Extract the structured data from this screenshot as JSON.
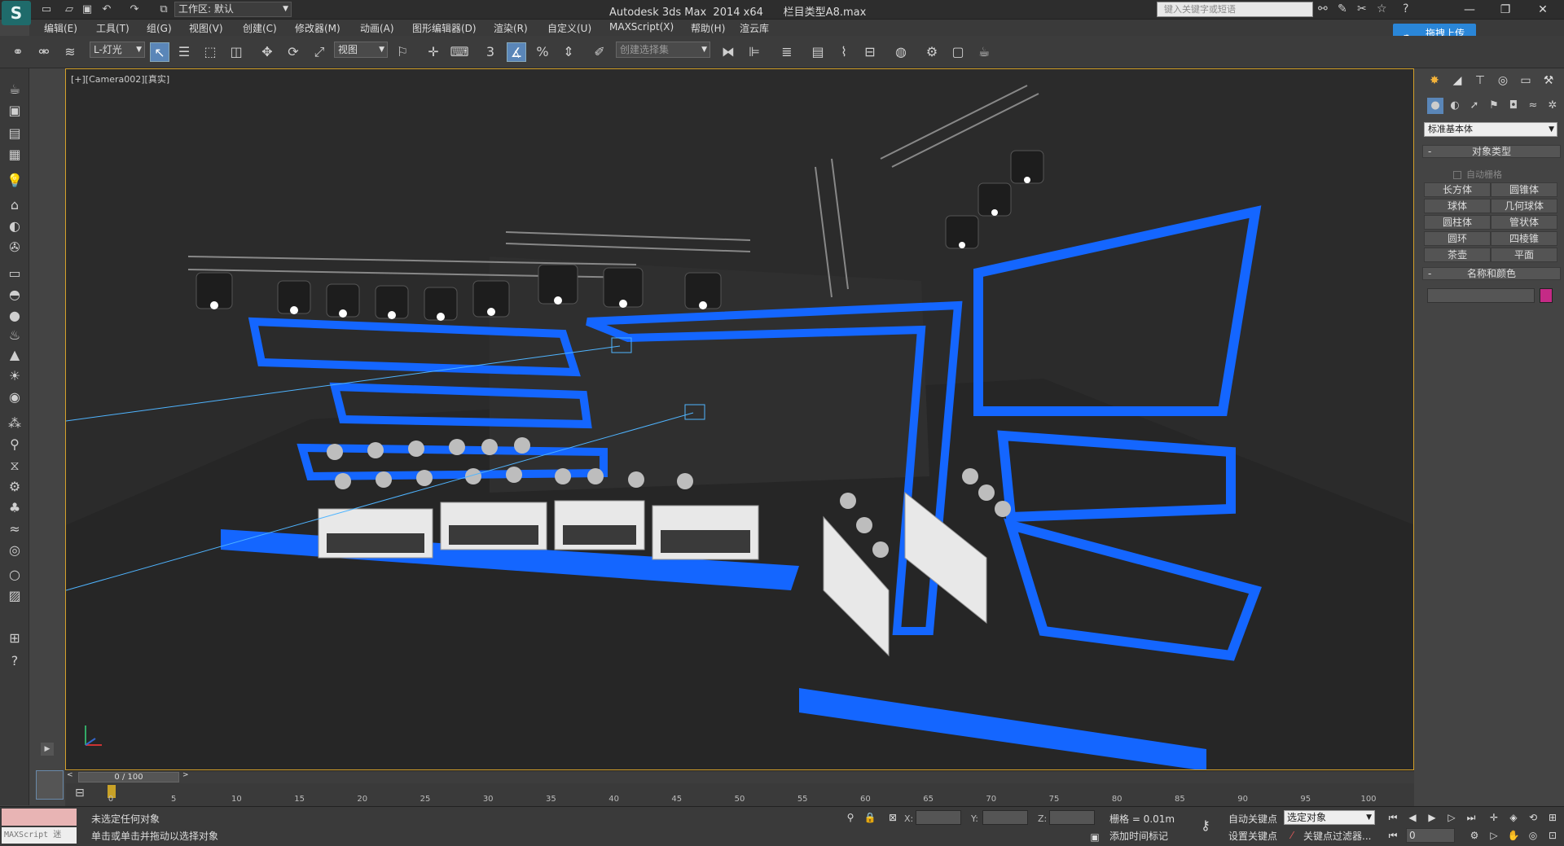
{
  "app": {
    "logo": "S",
    "workspace_label": "工作区: 默认",
    "window_title": "Autodesk 3ds Max  2014 x64      栏目类型A8.max",
    "search_placeholder": "键入关键字或短语"
  },
  "menu": [
    "编辑(E)",
    "工具(T)",
    "组(G)",
    "视图(V)",
    "创建(C)",
    "修改器(M)",
    "动画(A)",
    "图形编辑器(D)",
    "渲染(R)",
    "自定义(U)",
    "MAXScript(X)",
    "帮助(H)",
    "渲云库"
  ],
  "upload_button": "拖拽上传",
  "toolbar": {
    "filter_dropdown": "L-灯光",
    "reference_dropdown": "视图",
    "snap_number": "3",
    "selection_set_dropdown": "创建选择集"
  },
  "viewport": {
    "label": "[+][Camera002][真实]"
  },
  "command_panel": {
    "category_dropdown": "标准基本体",
    "object_type_title": "对象类型",
    "autogrid_label": "自动栅格",
    "object_buttons": [
      "长方体",
      "圆锥体",
      "球体",
      "几何球体",
      "圆柱体",
      "管状体",
      "圆环",
      "四棱锥",
      "茶壶",
      "平面"
    ],
    "name_color_title": "名称和颜色",
    "object_color": "#c52a86"
  },
  "timeline": {
    "slider_text": "0 / 100",
    "ticks": [
      "0",
      "5",
      "10",
      "15",
      "20",
      "25",
      "30",
      "35",
      "40",
      "45",
      "50",
      "55",
      "60",
      "65",
      "70",
      "75",
      "80",
      "85",
      "90",
      "95",
      "100"
    ]
  },
  "status": {
    "maxscript_label": "MAXScript 迷",
    "selection_status": "未选定任何对象",
    "prompt": "单击或单击并拖动以选择对象",
    "x_label": "X:",
    "y_label": "Y:",
    "z_label": "Z:",
    "grid": "栅格 = 0.01m",
    "add_time_tag": "添加时间标记",
    "auto_key": "自动关键点",
    "set_key": "设置关键点",
    "selected_dropdown": "选定对象",
    "key_filters": "关键点过滤器...",
    "frame_value": "0"
  }
}
